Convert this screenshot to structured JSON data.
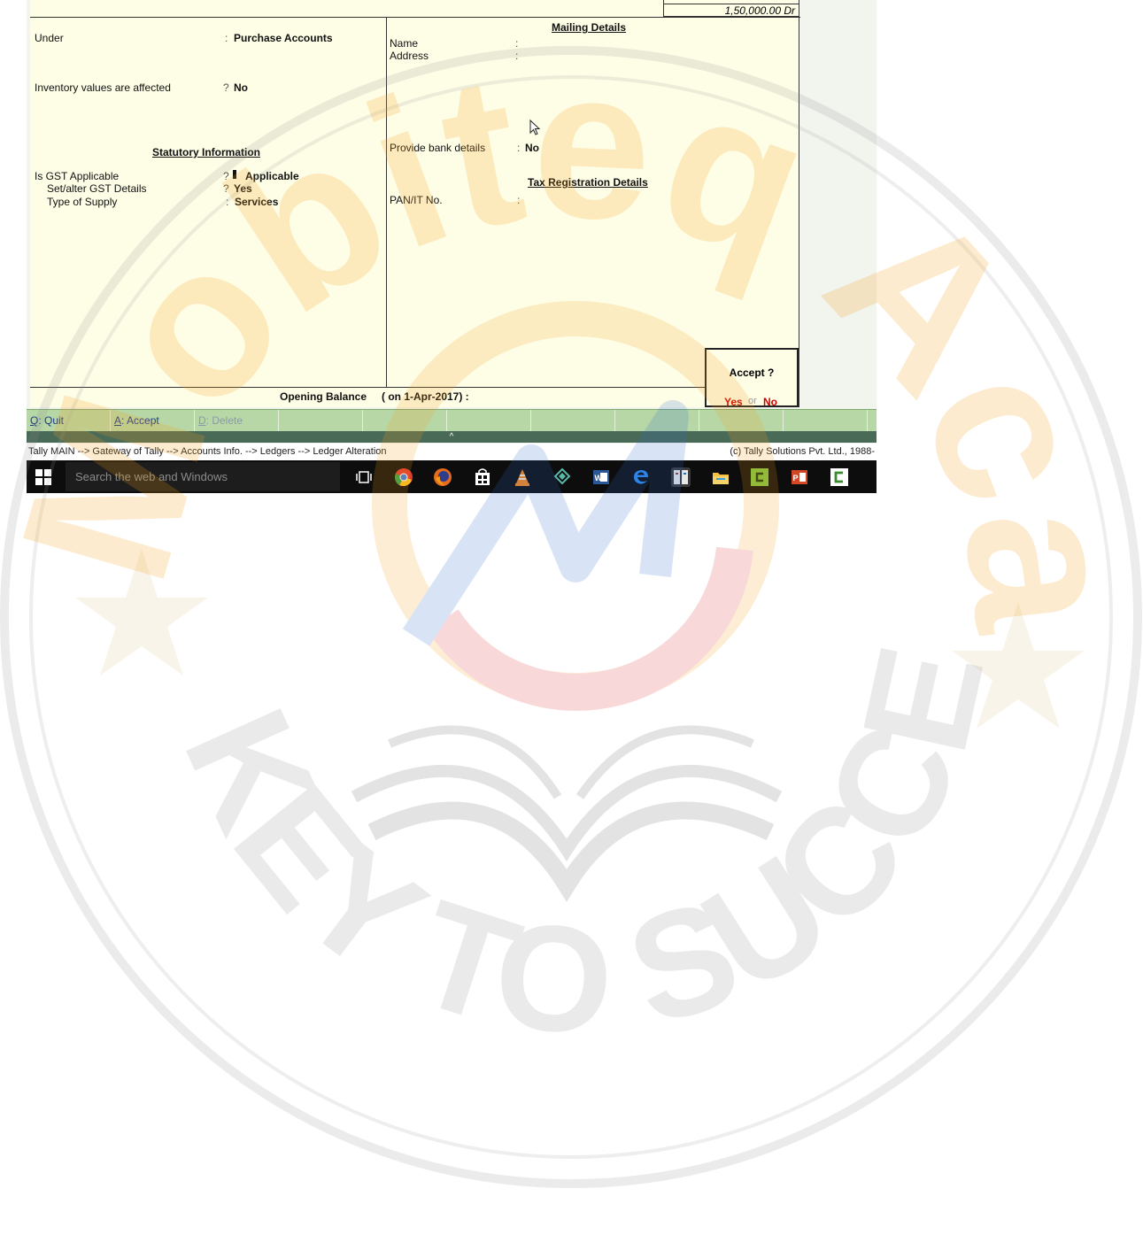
{
  "ledger": {
    "closing_balance": "1,50,000.00 Dr",
    "under_label": "Under",
    "under_value": "Purchase Accounts",
    "inventory_label": "Inventory values are affected",
    "inventory_value": "No",
    "statutory_header": "Statutory Information",
    "gst_applicable_label": "Is GST Applicable",
    "gst_applicable_value": "Applicable",
    "gst_details_label": "Set/alter GST Details",
    "gst_details_value": "Yes",
    "supply_label": "Type of Supply",
    "supply_value": "Services",
    "opening_balance_label": "Opening Balance",
    "opening_balance_date": "( on 1-Apr-2017) :"
  },
  "mailing": {
    "header": "Mailing Details",
    "name_label": "Name",
    "address_label": "Address",
    "bank_label": "Provide bank details",
    "bank_value": "No",
    "tax_header": "Tax Registration Details",
    "pan_label": "PAN/IT No."
  },
  "dialog": {
    "title": "Accept ?",
    "yes": "Yes",
    "or": "or",
    "no": "No"
  },
  "buttons": {
    "quit_key": "Q",
    "quit_label": ": Quit",
    "accept_key": "A",
    "accept_label": ": Accept",
    "delete_key": "D",
    "delete_label": ": Delete"
  },
  "status": {
    "collapse": "^",
    "breadcrumb": "Tally MAIN --> Gateway of Tally --> Accounts Info. --> Ledgers --> Ledger Alteration",
    "copyright": "(c) Tally Solutions Pvt. Ltd., 1988-"
  },
  "taskbar": {
    "search_placeholder": "Search the web and Windows",
    "icons": [
      "task-view-icon",
      "chrome-icon",
      "firefox-icon",
      "store-icon",
      "vlc-icon",
      "app-icon",
      "word-icon",
      "edge-icon",
      "tally-icon",
      "file-explorer-icon",
      "camtasia-icon",
      "powerpoint-icon",
      "camtasia-recorder-icon"
    ]
  },
  "watermark": {
    "brand": "Mobiteq Academy",
    "tagline": "KEY TO SUCCESS"
  },
  "colors": {
    "pane": "#fefde6",
    "button_bar": "#b7d7a6",
    "dialog_choice": "#d00000",
    "watermark_orange": "#f6a01a"
  }
}
